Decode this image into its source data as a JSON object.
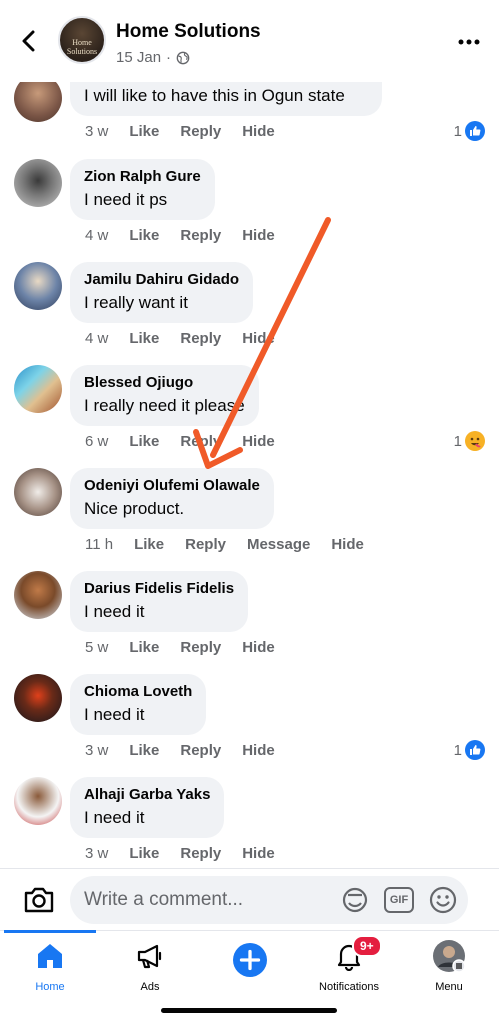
{
  "header": {
    "page_name": "Home Solutions",
    "avatar_text": "Home Solutions",
    "post_date": "15 Jan",
    "separator": "·"
  },
  "top_partial_comment": {
    "text": "I will like to have this in Ogun state",
    "time": "3 w",
    "like": "Like",
    "reply": "Reply",
    "hide": "Hide",
    "reaction_count": "1"
  },
  "comments": [
    {
      "name": "Zion Ralph Gure",
      "text": "I need it ps",
      "time": "4 w",
      "like": "Like",
      "reply": "Reply",
      "hide": "Hide",
      "reaction_count": ""
    },
    {
      "name": "Jamilu Dahiru Gidado",
      "text": "I really want it",
      "time": "4 w",
      "like": "Like",
      "reply": "Reply",
      "hide": "Hide",
      "reaction_count": ""
    },
    {
      "name": "Blessed Ojiugo",
      "text": "I really need it please",
      "time": "6 w",
      "like": "Like",
      "reply": "Reply",
      "hide": "Hide",
      "reaction_count": "1"
    },
    {
      "name": "Odeniyi Olufemi Olawale",
      "text": "Nice product.",
      "time": "11 h",
      "like": "Like",
      "reply": "Reply",
      "message": "Message",
      "hide": "Hide",
      "reaction_count": ""
    },
    {
      "name": "Darius Fidelis Fidelis",
      "text": "I need it",
      "time": "5 w",
      "like": "Like",
      "reply": "Reply",
      "hide": "Hide",
      "reaction_count": ""
    },
    {
      "name": "Chioma Loveth",
      "text": "I need it",
      "time": "3 w",
      "like": "Like",
      "reply": "Reply",
      "hide": "Hide",
      "reaction_count": "1"
    },
    {
      "name": "Alhaji Garba Yaks",
      "text": "I need it",
      "time": "3 w",
      "like": "Like",
      "reply": "Reply",
      "hide": "Hide",
      "reaction_count": ""
    }
  ],
  "composer": {
    "placeholder": "Write a comment...",
    "gif_label": "GIF"
  },
  "tabbar": {
    "home": "Home",
    "ads": "Ads",
    "notifications": "Notifications",
    "notifications_badge": "9+",
    "menu": "Menu"
  },
  "colors": {
    "accent": "#1877f2",
    "annotation_arrow": "#f05a28",
    "badge": "#e41e3f",
    "bubble": "#f0f2f5",
    "secondary_text": "#65676b"
  },
  "icons": [
    "back-arrow-icon",
    "globe-icon",
    "more-icon",
    "like-reaction-icon",
    "haha-reaction-icon",
    "camera-icon",
    "sticker-icon",
    "gif-icon",
    "emoji-icon",
    "home-icon",
    "megaphone-icon",
    "plus-icon",
    "bell-icon",
    "profile-avatar-icon"
  ]
}
